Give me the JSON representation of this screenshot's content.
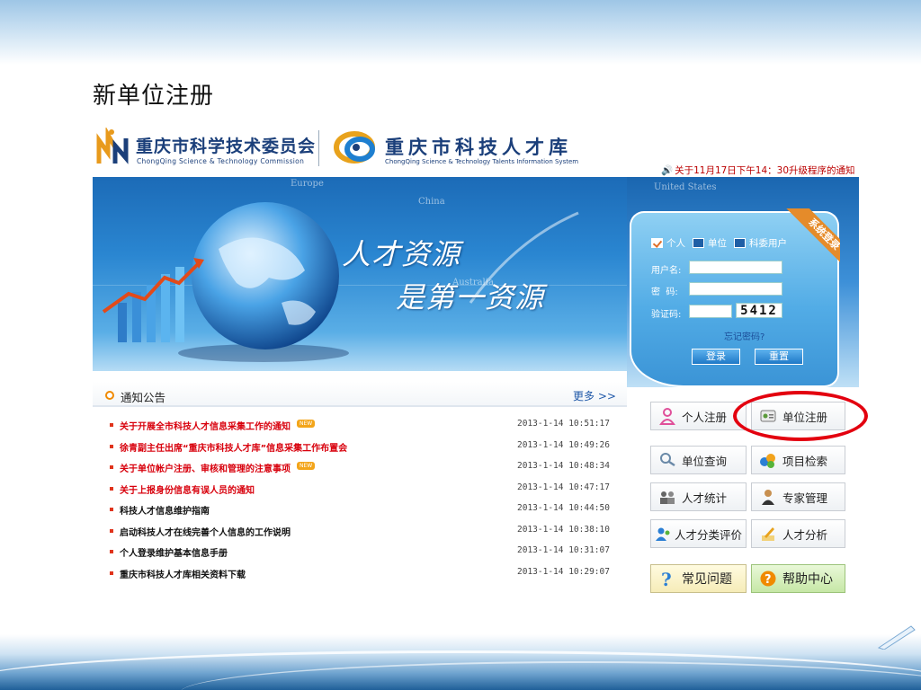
{
  "slide": {
    "title": "新单位注册"
  },
  "header": {
    "left_logo": {
      "cn": "重庆市科学技术委员会",
      "en": "ChongQing Science & Technology Commission"
    },
    "right_logo": {
      "cn": "重庆市科技人才库",
      "en": "ChongQing Science & Technology Talents Information System"
    },
    "top_notice": "关于11月17日下午14：30升级程序的通知"
  },
  "banner": {
    "slogan_line1": "人才资源",
    "slogan_line2": "是第一资源",
    "map_labels": [
      "Europe",
      "China",
      "Australia",
      "United States"
    ]
  },
  "login": {
    "ribbon": "系统登录",
    "options": [
      "个人",
      "单位",
      "科委用户"
    ],
    "username_label": "用户名:",
    "password_label": "密  码:",
    "captcha_label": "验证码:",
    "captcha_value": "5412",
    "forgot": "忘记密码?",
    "login_button": "登录",
    "reset_button": "重置"
  },
  "notices": {
    "title": "通知公告",
    "more": "更多 >>",
    "new_tag": "NEW",
    "items": [
      {
        "title": "关于开展全市科技人才信息采集工作的通知",
        "date": "2013-1-14 10:51:17",
        "red": true,
        "new": true
      },
      {
        "title": "徐青副主任出席“重庆市科技人才库”信息采集工作布置会",
        "date": "2013-1-14 10:49:26",
        "red": true,
        "new": false
      },
      {
        "title": "关于单位帐户注册、审核和管理的注意事项",
        "date": "2013-1-14 10:48:34",
        "red": true,
        "new": true
      },
      {
        "title": "关于上报身份信息有误人员的通知",
        "date": "2013-1-14 10:47:17",
        "red": true,
        "new": false
      },
      {
        "title": "科技人才信息维护指南",
        "date": "2013-1-14 10:44:50",
        "red": false,
        "new": false
      },
      {
        "title": "启动科技人才在线完善个人信息的工作说明",
        "date": "2013-1-14 10:38:10",
        "red": false,
        "new": false
      },
      {
        "title": "个人登录维护基本信息手册",
        "date": "2013-1-14 10:31:07",
        "red": false,
        "new": false
      },
      {
        "title": "重庆市科技人才库相关资料下载",
        "date": "2013-1-14 10:29:07",
        "red": false,
        "new": false
      }
    ]
  },
  "actions": {
    "personal_register": "个人注册",
    "unit_register": "单位注册",
    "unit_query": "单位查询",
    "project_search": "项目检索",
    "talent_stats": "人才统计",
    "expert_manage": "专家管理",
    "talent_classify": "人才分类评价",
    "talent_analysis": "人才分析",
    "faq": "常见问题",
    "help_center": "帮助中心"
  },
  "colors": {
    "accent_red": "#e3000f",
    "notice_red": "#d8000c",
    "brand_blue": "#1b3f7a"
  }
}
